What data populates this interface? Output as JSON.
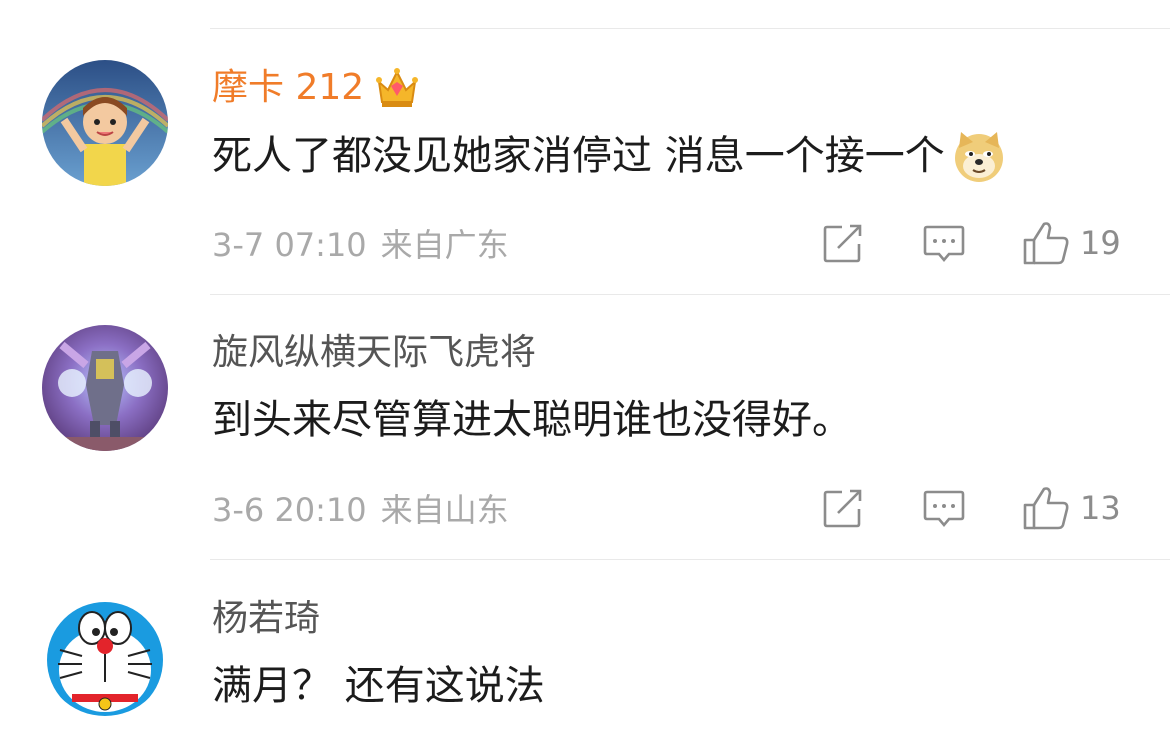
{
  "comments": [
    {
      "username": "摩卡 212",
      "text": "死人了都没见她家消停过 消息一个接一个",
      "time": "3-7 07:10",
      "location": "来自广东",
      "likes": "19"
    },
    {
      "username": "旋风纵横天际飞虎将",
      "text": "到头来尽管算进太聪明谁也没得好。",
      "time": "3-6 20:10",
      "location": "来自山东",
      "likes": "13"
    },
    {
      "username": "杨若琦",
      "text": "满月？  还有这说法"
    }
  ],
  "icons": {
    "vip_badge": "crown-icon",
    "emoji": "doge-icon",
    "share": "share-icon",
    "reply": "comment-icon",
    "like": "thumbs-up-icon"
  },
  "colors": {
    "vip_name": "#f07c29",
    "name": "#555555",
    "text": "#1c1c1c",
    "meta": "#a9a9a9"
  }
}
